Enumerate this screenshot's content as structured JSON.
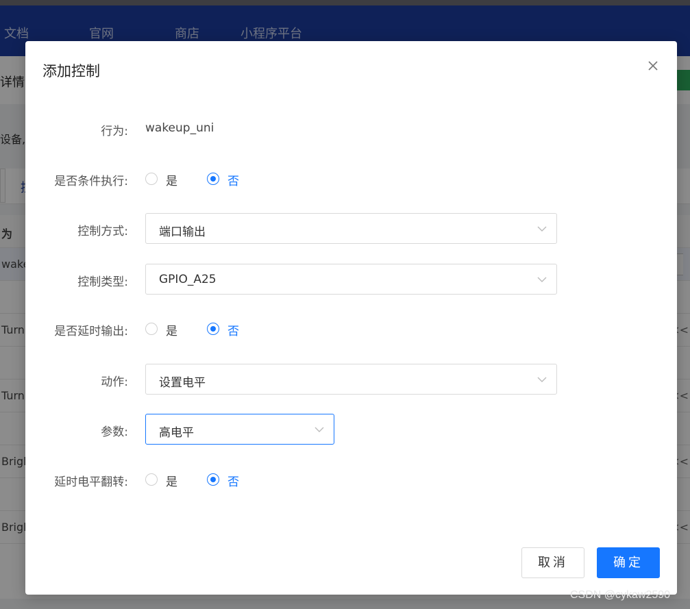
{
  "background": {
    "nav_items": [
      "文档",
      "官网",
      "商店",
      "小程序平台"
    ],
    "subheader_title": "详情",
    "info_text": "设备,",
    "tab_link": "控",
    "table_head": "为",
    "rows": [
      "wake",
      "Turn",
      "Turn",
      "Brigh",
      "Brigh"
    ],
    "row_right_mark": "<<"
  },
  "dialog": {
    "title": "添加控制",
    "fields": {
      "behavior": {
        "label": "行为:",
        "value": "wakeup_uni"
      },
      "conditional": {
        "label": "是否条件执行:",
        "options": [
          "是",
          "否"
        ],
        "selected": "否"
      },
      "control_mode": {
        "label": "控制方式:",
        "value": "端口输出"
      },
      "control_type": {
        "label": "控制类型:",
        "value": "GPIO_A25"
      },
      "delay_output": {
        "label": "是否延时输出:",
        "options": [
          "是",
          "否"
        ],
        "selected": "否"
      },
      "action": {
        "label": "动作:",
        "value": "设置电平"
      },
      "param": {
        "label": "参数:",
        "value": "高电平"
      },
      "delay_flip": {
        "label": "延时电平翻转:",
        "options": [
          "是",
          "否"
        ],
        "selected": "否"
      }
    },
    "buttons": {
      "cancel": "取消",
      "ok": "确定"
    }
  },
  "watermark": "CSDN @cykaw2590",
  "colors": {
    "primary": "#1677ff",
    "nav": "#1c3da0"
  }
}
